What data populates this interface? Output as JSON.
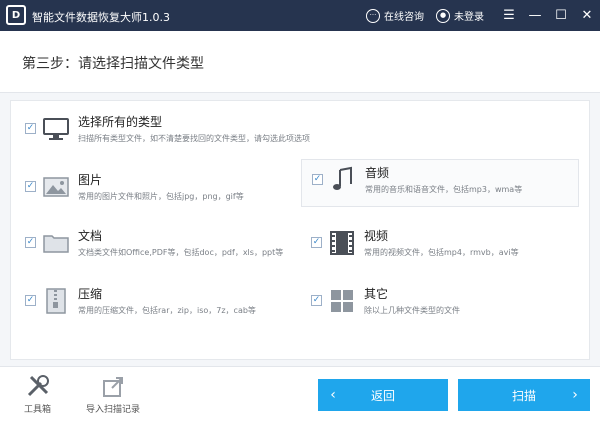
{
  "window": {
    "logo_text": "D",
    "title": "智能文件数据恢复大师1.0.3",
    "online_chat": "在线咨询",
    "login": "未登录"
  },
  "header": {
    "step_title": "第三步：请选择扫描文件类型"
  },
  "options": {
    "all": {
      "title": "选择所有的类型",
      "desc": "扫描所有类型文件，如不清楚要找回的文件类型，请勾选此项选项",
      "checked": true
    },
    "pictures": {
      "title": "图片",
      "desc": "常用的图片文件和照片，包括jpg，png，gif等",
      "checked": true
    },
    "audio": {
      "title": "音频",
      "desc": "常用的音乐和语音文件，包括mp3，wma等",
      "checked": true
    },
    "documents": {
      "title": "文档",
      "desc": "文档类文件如Office,PDF等，包括doc，pdf，xls，ppt等",
      "checked": true
    },
    "video": {
      "title": "视频",
      "desc": "常用的视频文件，包括mp4，rmvb，avi等",
      "checked": true
    },
    "archives": {
      "title": "压缩",
      "desc": "常用的压缩文件，包括rar，zip，iso，7z，cab等",
      "checked": true
    },
    "other": {
      "title": "其它",
      "desc": "除以上几种文件类型的文件",
      "checked": true
    }
  },
  "footer": {
    "toolbox": "工具箱",
    "import_record": "导入扫描记录",
    "back": "返回",
    "scan": "扫描"
  },
  "colors": {
    "titlebar": "#26344f",
    "accent": "#1fa6ec",
    "check": "#3a87c9"
  }
}
